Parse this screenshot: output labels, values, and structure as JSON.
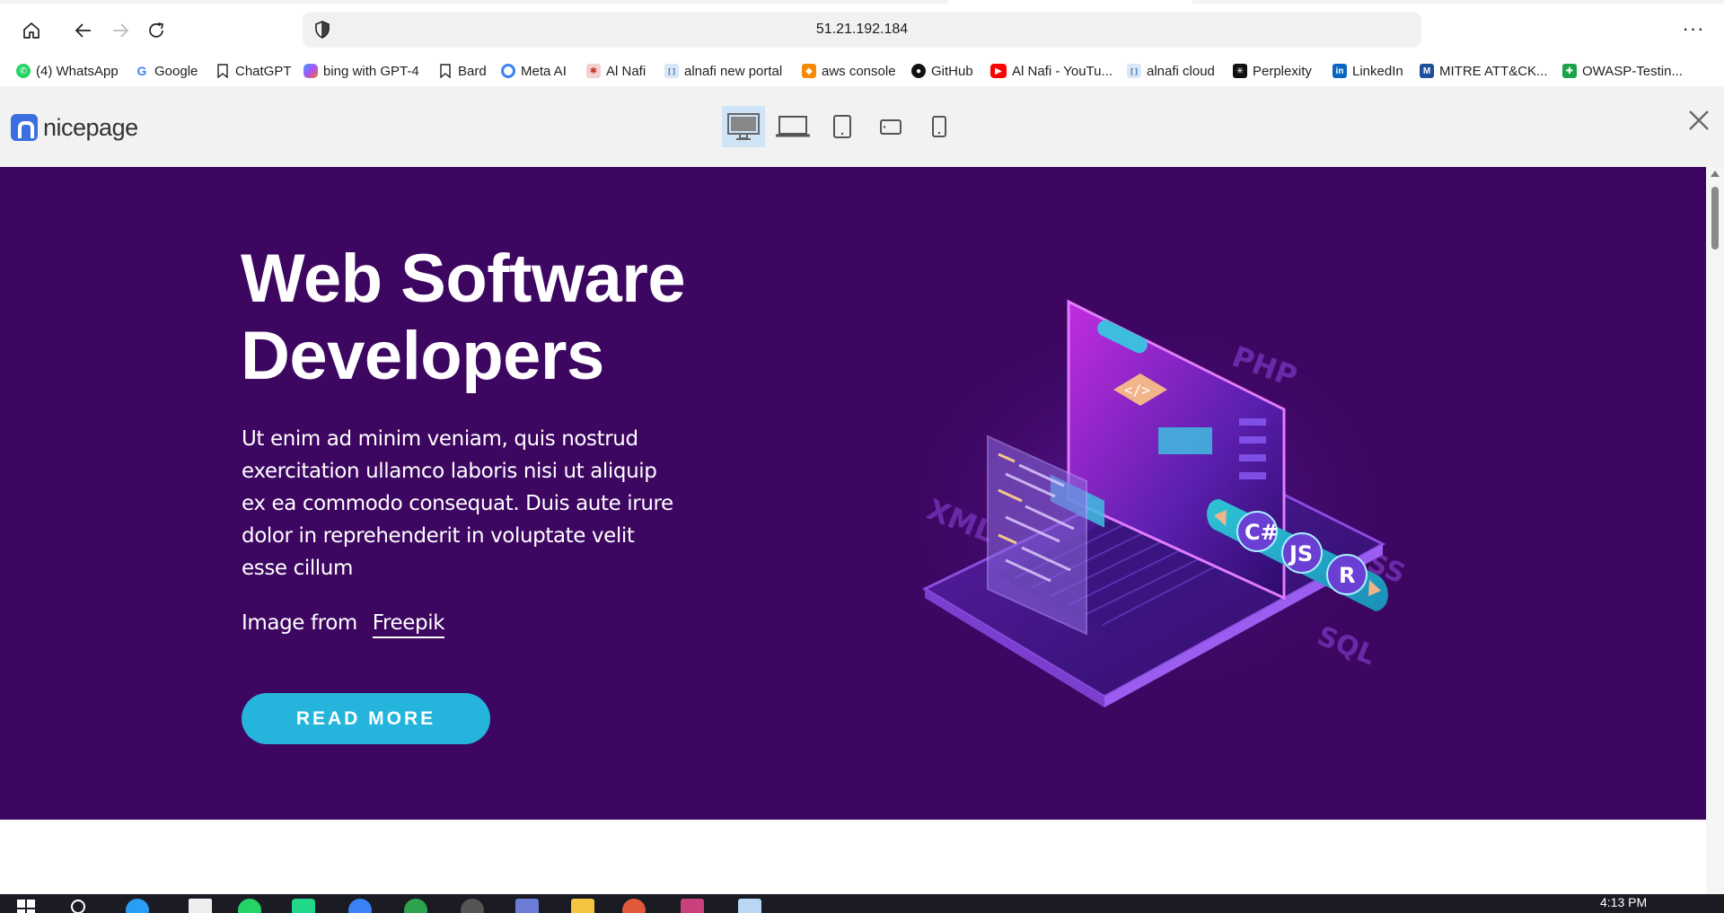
{
  "browser": {
    "url": "51.21.192.184",
    "menu_label": "···",
    "bookmarks": [
      {
        "label": "(4) WhatsApp",
        "icon": "whatsapp-icon",
        "color": "#25d366"
      },
      {
        "label": "Google",
        "icon": "google-icon",
        "color": "#4285f4"
      },
      {
        "label": "ChatGPT",
        "icon": "bookmark-icon",
        "color": "#ffffff"
      },
      {
        "label": "bing with GPT-4",
        "icon": "copilot-icon",
        "color": "#7b5cff"
      },
      {
        "label": "Bard",
        "icon": "bookmark-icon",
        "color": "#ffffff"
      },
      {
        "label": "Meta AI",
        "icon": "meta-ai-icon",
        "color": "#1877f2"
      },
      {
        "label": "Al Nafi",
        "icon": "alnafi-icon",
        "color": "#c0392b"
      },
      {
        "label": "alnafi new portal",
        "icon": "alnafi-portal-icon",
        "color": "#2b6cb0"
      },
      {
        "label": "aws console",
        "icon": "aws-icon",
        "color": "#f58a07"
      },
      {
        "label": "GitHub",
        "icon": "github-icon",
        "color": "#111111"
      },
      {
        "label": "Al Nafi - YouTu...",
        "icon": "youtube-icon",
        "color": "#ff0000"
      },
      {
        "label": "alnafi cloud",
        "icon": "alnafi-cloud-icon",
        "color": "#2b6cb0"
      },
      {
        "label": "Perplexity",
        "icon": "perplexity-icon",
        "color": "#111111"
      },
      {
        "label": "LinkedIn",
        "icon": "linkedin-icon",
        "color": "#0a66c2"
      },
      {
        "label": "MITRE ATT&CK...",
        "icon": "mitre-icon",
        "color": "#1f4e9c"
      },
      {
        "label": "OWASP-Testin...",
        "icon": "owasp-icon",
        "color": "#1aa34a"
      }
    ],
    "more_bookmarks": "»"
  },
  "preview_bar": {
    "logo_text": "nicepage",
    "devices": [
      "desktop",
      "laptop",
      "tablet",
      "tablet-landscape",
      "phone"
    ],
    "active_device": "desktop"
  },
  "hero": {
    "title_line1": "Web Software",
    "title_line2": "Developers",
    "description": "Ut enim ad minim veniam, quis nostrud exercitation ullamco laboris nisi ut aliquip ex ea commodo consequat. Duis aute irure dolor in reprehenderit in voluptate velit esse cillum",
    "credit_prefix": "Image from",
    "credit_link": "Freepik",
    "button_label": "READ MORE",
    "background": "#3c0661",
    "button_color": "#25b4dc"
  },
  "illustration": {
    "tags": [
      "PHP",
      "XML",
      "CSS",
      "SQL",
      "C#",
      "JS",
      "R",
      "</>"
    ]
  },
  "taskbar": {
    "time": "4:13 PM"
  }
}
